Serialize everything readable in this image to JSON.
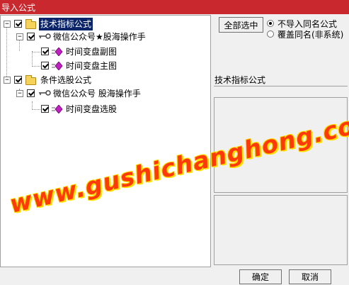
{
  "window": {
    "title": "导入公式"
  },
  "tree": {
    "groups": [
      {
        "label": "技术指标公式",
        "author": "微信公众号★股海操作手",
        "items": [
          "时间变盘副图",
          "时间变盘主图"
        ]
      },
      {
        "label": "条件选股公式",
        "author": "微信公众号 股海操作手",
        "items": [
          "时间变盘选股"
        ]
      }
    ]
  },
  "options": {
    "select_all_label": "全部选中",
    "radio_no_import": "不导入同名公式",
    "radio_overwrite": "覆盖同名(非系统)",
    "selected": "radio_no_import"
  },
  "detail": {
    "category_label": "技术指标公式"
  },
  "buttons": {
    "ok": "确定",
    "cancel": "取消"
  },
  "watermark": {
    "text": "www.gushichanghong.com"
  },
  "colors": {
    "titlebar": "#c8282e",
    "selection": "#0a246a",
    "watermark": "#ff3a0a"
  }
}
